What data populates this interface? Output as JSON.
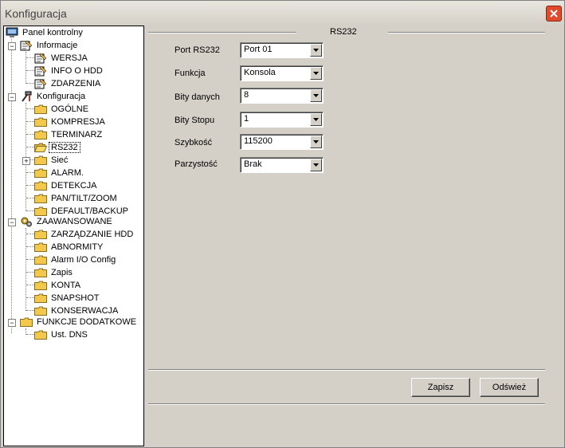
{
  "window": {
    "title": "Konfiguracja"
  },
  "tree": {
    "items": [
      {
        "label": "Panel kontrolny",
        "icon": "monitor-icon"
      },
      {
        "label": "Informacje",
        "icon": "notepad-icon"
      },
      {
        "label": "WERSJA",
        "icon": "notepad-icon"
      },
      {
        "label": "INFO O HDD",
        "icon": "notepad-icon"
      },
      {
        "label": "ZDARZENIA",
        "icon": "notepad-icon"
      },
      {
        "label": "Konfiguracja",
        "icon": "tools-icon"
      },
      {
        "label": "OGÓLNE",
        "icon": "folder-icon"
      },
      {
        "label": "KOMPRESJA",
        "icon": "folder-icon"
      },
      {
        "label": "TERMINARZ",
        "icon": "folder-icon"
      },
      {
        "label": "RS232",
        "icon": "folder-open-icon"
      },
      {
        "label": "Sieć",
        "icon": "folder-icon"
      },
      {
        "label": "ALARM.",
        "icon": "folder-icon"
      },
      {
        "label": "DETEKCJA",
        "icon": "folder-icon"
      },
      {
        "label": "PAN/TILT/ZOOM",
        "icon": "folder-icon"
      },
      {
        "label": "DEFAULT/BACKUP",
        "icon": "folder-icon"
      },
      {
        "label": "ZAAWANSOWANE",
        "icon": "gears-icon"
      },
      {
        "label": "ZARZĄDZANIE HDD",
        "icon": "folder-icon"
      },
      {
        "label": "ABNORMITY",
        "icon": "folder-icon"
      },
      {
        "label": "Alarm I/O Config",
        "icon": "folder-icon"
      },
      {
        "label": "Zapis",
        "icon": "folder-icon"
      },
      {
        "label": "KONTA",
        "icon": "folder-icon"
      },
      {
        "label": "SNAPSHOT",
        "icon": "folder-icon"
      },
      {
        "label": "KONSERWACJA",
        "icon": "folder-icon"
      },
      {
        "label": "FUNKCJE DODATKOWE",
        "icon": "folder-icon"
      },
      {
        "label": "Ust. DNS",
        "icon": "folder-icon"
      }
    ]
  },
  "panel": {
    "section_title": "RS232",
    "fields": [
      {
        "label": "Port RS232",
        "value": "Port 01"
      },
      {
        "label": "Funkcja",
        "value": "Konsola"
      },
      {
        "label": "Bity danych",
        "value": "8"
      },
      {
        "label": "Bity Stopu",
        "value": "1"
      },
      {
        "label": "Szybkość",
        "value": "115200"
      },
      {
        "label": "Parzystość",
        "value": "Brak"
      }
    ],
    "buttons": {
      "save": "Zapisz",
      "refresh": "Odśwież"
    }
  },
  "colors": {
    "face": "#d4d0c8",
    "close": "#e04b2e",
    "folder": "#f2c94c"
  }
}
